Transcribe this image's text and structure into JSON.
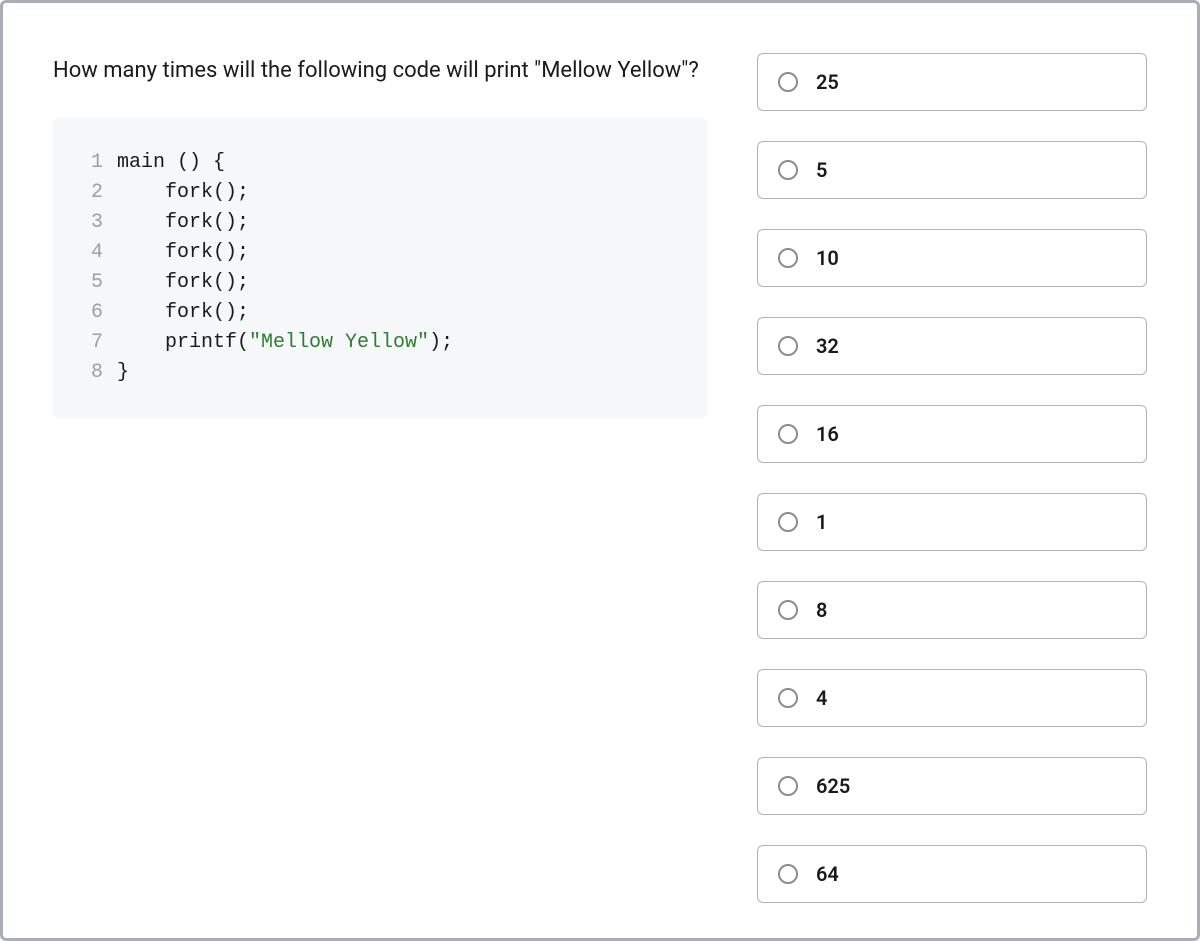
{
  "question": {
    "text": "How many times will the following code will print \"Mellow Yellow\"?"
  },
  "code": {
    "lines": [
      {
        "num": "1",
        "pre": "",
        "plain": "main () {",
        "string": "",
        "post": ""
      },
      {
        "num": "2",
        "pre": "    ",
        "plain": "fork();",
        "string": "",
        "post": ""
      },
      {
        "num": "3",
        "pre": "    ",
        "plain": "fork();",
        "string": "",
        "post": ""
      },
      {
        "num": "4",
        "pre": "    ",
        "plain": "fork();",
        "string": "",
        "post": ""
      },
      {
        "num": "5",
        "pre": "    ",
        "plain": "fork();",
        "string": "",
        "post": ""
      },
      {
        "num": "6",
        "pre": "    ",
        "plain": "fork();",
        "string": "",
        "post": ""
      },
      {
        "num": "7",
        "pre": "    ",
        "plain": "printf(",
        "string": "\"Mellow Yellow\"",
        "post": ");"
      },
      {
        "num": "8",
        "pre": "",
        "plain": "}",
        "string": "",
        "post": ""
      }
    ]
  },
  "answers": [
    {
      "label": "25"
    },
    {
      "label": "5"
    },
    {
      "label": "10"
    },
    {
      "label": "32"
    },
    {
      "label": "16"
    },
    {
      "label": "1"
    },
    {
      "label": "8"
    },
    {
      "label": "4"
    },
    {
      "label": "625"
    },
    {
      "label": "64"
    }
  ]
}
